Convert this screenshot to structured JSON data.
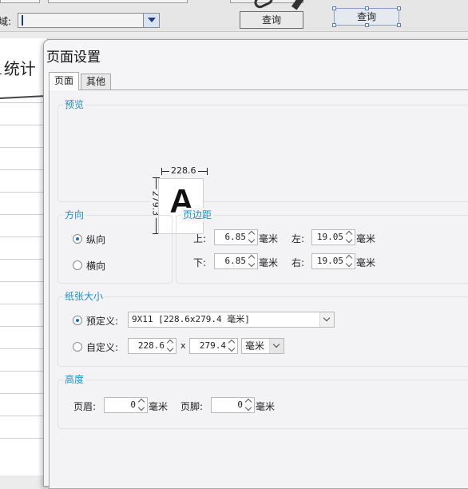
{
  "background": {
    "partial_label": "域:",
    "title_partial": "1统计",
    "query_button_1": "查询",
    "query_button_2": "查询"
  },
  "dialog": {
    "title": "页面设置",
    "tabs": [
      "页面",
      "其他"
    ],
    "preview": {
      "label": "预览",
      "width": "228.6",
      "height": "279.3",
      "sample_letter": "A"
    },
    "orientation": {
      "label": "方向",
      "portrait": "纵向",
      "landscape": "横向",
      "selected": "纵向"
    },
    "margins": {
      "label": "页边距",
      "top_label": "上:",
      "top_value": "6.85",
      "left_label": "左:",
      "left_value": "19.05",
      "bottom_label": "下:",
      "bottom_value": "6.85",
      "right_label": "右:",
      "right_value": "19.05",
      "unit": "毫米"
    },
    "paper": {
      "label": "纸张大小",
      "predefined_label": "预定义:",
      "predefined_value": "9X11 [228.6x279.4 毫米]",
      "custom_label": "自定义:",
      "custom_width": "228.6",
      "times": "x",
      "custom_height": "279.4",
      "custom_unit": "毫米"
    },
    "height": {
      "label": "高度",
      "header_label": "页眉:",
      "header_value": "0",
      "footer_label": "页脚:",
      "footer_value": "0",
      "unit": "毫米"
    }
  }
}
